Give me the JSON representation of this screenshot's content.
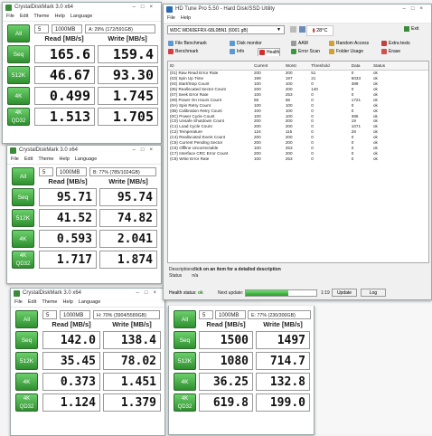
{
  "cdm1": {
    "title": "CrystalDiskMark 3.0 x64",
    "menu": [
      "File",
      "Edit",
      "Theme",
      "Help",
      "Language"
    ],
    "all_label": "All",
    "count": "5",
    "size": "1000MB",
    "drive": "A: 29% (172/591GB)",
    "read_header": "Read [MB/s]",
    "write_header": "Write [MB/s]",
    "rows": [
      {
        "label": "Seq",
        "read": "165.6",
        "write": "159.4"
      },
      {
        "label": "512K",
        "read": "46.67",
        "write": "93.30"
      },
      {
        "label": "4K",
        "read": "0.499",
        "write": "1.745"
      },
      {
        "label": "4K\nQD32",
        "read": "1.513",
        "write": "1.705"
      }
    ]
  },
  "cdm2": {
    "title": "CrystalDiskMark 3.0 x64",
    "menu": [
      "File",
      "Edit",
      "Theme",
      "Help",
      "Language"
    ],
    "all_label": "All",
    "count": "5",
    "size": "1000MB",
    "drive": "B: 77% (785/1024GB)",
    "read_header": "Read [MB/s]",
    "write_header": "Write [MB/s]",
    "rows": [
      {
        "label": "Seq",
        "read": "95.71",
        "write": "95.74"
      },
      {
        "label": "512K",
        "read": "41.52",
        "write": "74.82"
      },
      {
        "label": "4K",
        "read": "0.593",
        "write": "2.041"
      },
      {
        "label": "4K\nQD32",
        "read": "1.717",
        "write": "1.874"
      }
    ]
  },
  "cdm3": {
    "title": "CrystalDiskMark 3.0 x64",
    "menu": [
      "File",
      "Edit",
      "Theme",
      "Help",
      "Language"
    ],
    "all_label": "All",
    "count": "5",
    "size": "1000MB",
    "drive": "H: 70% (3904/5589GB)",
    "read_header": "Read [MB/s]",
    "write_header": "Write [MB/s]",
    "rows": [
      {
        "label": "Seq",
        "read": "142.0",
        "write": "138.4"
      },
      {
        "label": "512K",
        "read": "35.45",
        "write": "78.02"
      },
      {
        "label": "4K",
        "read": "0.373",
        "write": "1.451"
      },
      {
        "label": "4K\nQD32",
        "read": "1.124",
        "write": "1.379"
      }
    ]
  },
  "cdm4": {
    "all_label": "All",
    "count": "5",
    "size": "1000MB",
    "drive": "E: 77% (230/300GB)",
    "read_header": "Read [MB/s]",
    "write_header": "Write [MB/s]",
    "rows": [
      {
        "label": "Seq",
        "read": "1500",
        "write": "1497"
      },
      {
        "label": "512K",
        "read": "1080",
        "write": "714.7"
      },
      {
        "label": "4K",
        "read": "36.25",
        "write": "132.8"
      },
      {
        "label": "4K\nQD32",
        "read": "619.8",
        "write": "199.0"
      }
    ]
  },
  "hdtune": {
    "title": "HD Tune Pro 5.50 - Hard Disk/SSD Utility",
    "menu": [
      "File",
      "Help"
    ],
    "drive": "WDC WD60EFRX-68L0BN1 (6001 gB)",
    "temperature": "28°C",
    "exit_label": "Exit",
    "tabs_row1": [
      "File Benchmark",
      "Disk monitor",
      "AAM",
      "Random Access",
      "Extra tests"
    ],
    "tabs_row2": [
      "Benchmark",
      "Info",
      "Health",
      "Error Scan",
      "Folder Usage",
      "Erase"
    ],
    "columns": [
      "ID",
      "Current",
      "Worst",
      "Threshold",
      "Data",
      "Status"
    ],
    "smart_rows": [
      [
        "(01) Raw Read Error Rate",
        "200",
        "200",
        "51",
        "0",
        "ok"
      ],
      [
        "(03) Spin Up Time",
        "199",
        "197",
        "21",
        "5033",
        "ok"
      ],
      [
        "(04) Start/Stop Count",
        "100",
        "100",
        "0",
        "389",
        "ok"
      ],
      [
        "(05) Reallocated Sector Count",
        "200",
        "200",
        "140",
        "0",
        "ok"
      ],
      [
        "(07) Seek Error Rate",
        "100",
        "253",
        "0",
        "0",
        "ok"
      ],
      [
        "(09) Power On Hours Count",
        "58",
        "58",
        "0",
        "1721",
        "ok"
      ],
      [
        "(0A) Spin Retry Count",
        "100",
        "100",
        "0",
        "0",
        "ok"
      ],
      [
        "(0B) Calibration Retry Count",
        "100",
        "100",
        "0",
        "0",
        "ok"
      ],
      [
        "(0C) Power Cycle Count",
        "100",
        "100",
        "0",
        "385",
        "ok"
      ],
      [
        "(C0) Unsafe Shutdown Count",
        "200",
        "200",
        "0",
        "19",
        "ok"
      ],
      [
        "(C1) Load Cycle Count",
        "200",
        "200",
        "0",
        "1071",
        "ok"
      ],
      [
        "(C2) Temperature",
        "124",
        "115",
        "0",
        "28",
        "ok"
      ],
      [
        "(C4) Reallocated Event Count",
        "200",
        "200",
        "0",
        "0",
        "ok"
      ],
      [
        "(C5) Current Pending Sector",
        "200",
        "200",
        "0",
        "0",
        "ok"
      ],
      [
        "(C6) Offline Uncorrectable",
        "100",
        "253",
        "0",
        "0",
        "ok"
      ],
      [
        "(C7) Interface CRC Error Count",
        "200",
        "200",
        "0",
        "0",
        "ok"
      ],
      [
        "(C8) Write Error Rate",
        "100",
        "253",
        "0",
        "0",
        "ok"
      ]
    ],
    "description_label": "Description",
    "description_value": "click on an item for a detailed description",
    "status_label": "Status",
    "status_value": "n/a",
    "health_label": "Health status:",
    "health_value": "ok",
    "next_update_label": "Next update:",
    "next_update_value": "1:19",
    "update_button": "Update",
    "log_button": "Log"
  }
}
